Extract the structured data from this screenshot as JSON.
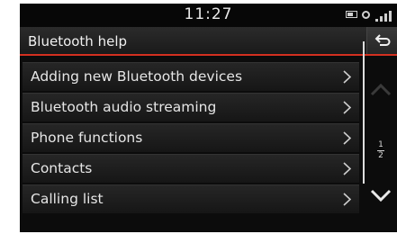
{
  "status": {
    "time": "11:27"
  },
  "header": {
    "title": "Bluetooth help"
  },
  "menu": {
    "items": [
      {
        "label": "Adding new Bluetooth devices"
      },
      {
        "label": "Bluetooth audio streaming"
      },
      {
        "label": "Phone functions"
      },
      {
        "label": "Contacts"
      },
      {
        "label": "Calling list"
      }
    ]
  },
  "pager": {
    "current": "1",
    "total": "2"
  },
  "colors": {
    "accent": "#d33020",
    "background": "#0c0c0c",
    "text": "#e6e6e6"
  }
}
